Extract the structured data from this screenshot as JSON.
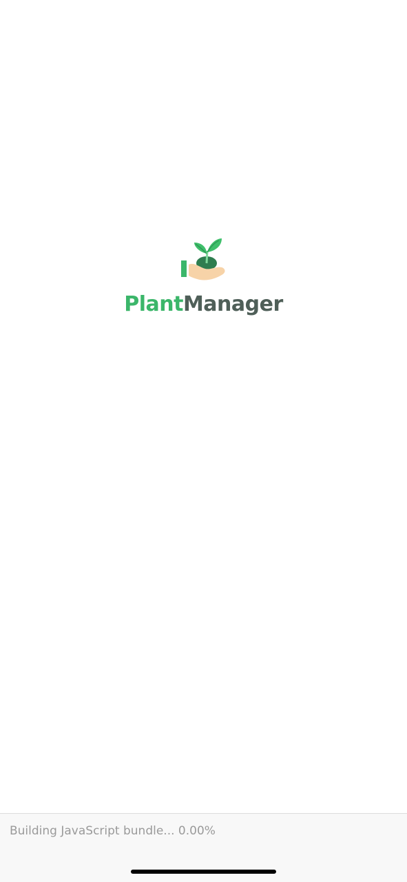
{
  "app": {
    "logo_part1": "Plant",
    "logo_part2": "Manager",
    "logo_icon": "hand-sprout-icon"
  },
  "colors": {
    "brand_green": "#3bb66a",
    "brand_dark": "#4f5f58",
    "leaf_green": "#3fbf6b",
    "soil": "#2e7d4f",
    "hand": "#f7d3a8"
  },
  "status_bar": {
    "message": "Building JavaScript bundle... 0.00%"
  }
}
